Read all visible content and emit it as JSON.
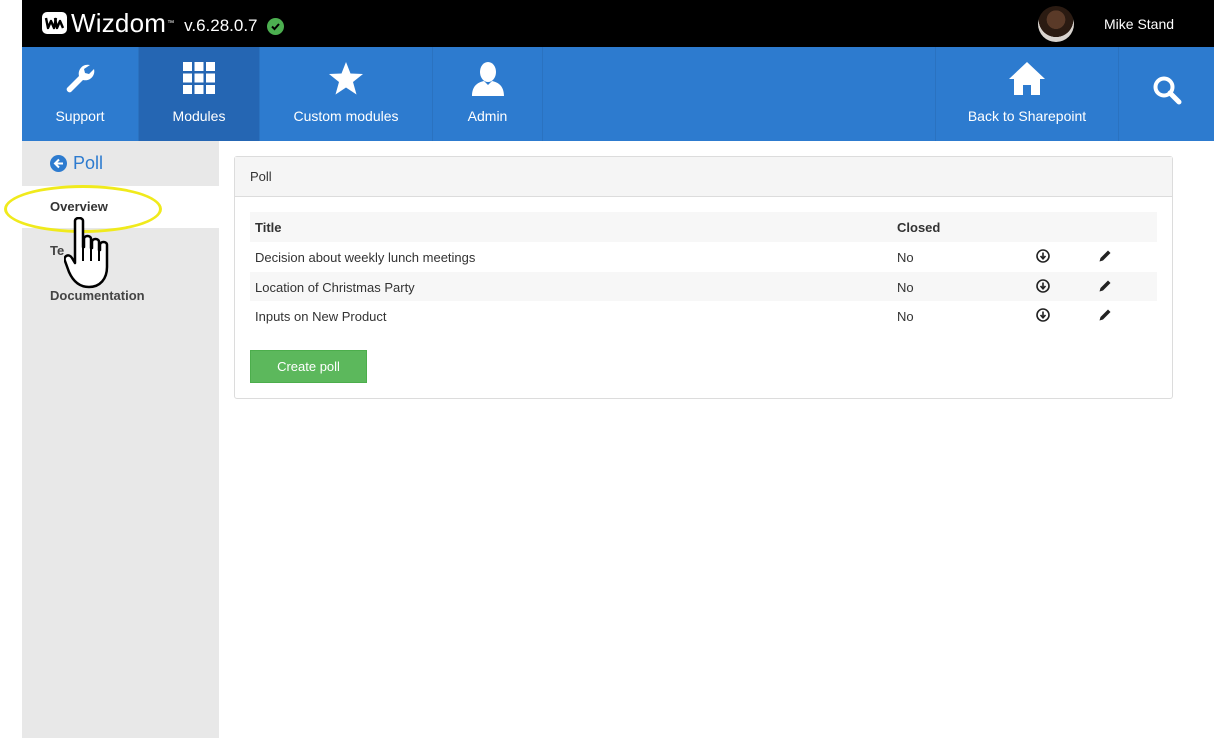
{
  "topbar": {
    "logo_text": "Wizdom",
    "logo_tm": "™",
    "version": "v.6.28.0.7",
    "user_name": "Mike Stand"
  },
  "nav": {
    "items": [
      {
        "label": "Support",
        "icon": "wrench-icon"
      },
      {
        "label": "Modules",
        "icon": "grid-icon",
        "active": true
      },
      {
        "label": "Custom modules",
        "icon": "star-icon"
      },
      {
        "label": "Admin",
        "icon": "user-icon"
      },
      {
        "label": "Back to Sharepoint",
        "icon": "home-icon"
      }
    ],
    "search_icon": "search-icon"
  },
  "sidebar": {
    "title": "Poll",
    "items": [
      {
        "label": "Overview",
        "active": true
      },
      {
        "label": "Te"
      },
      {
        "label": "Documentation"
      }
    ]
  },
  "panel": {
    "title": "Poll",
    "columns": {
      "title": "Title",
      "closed": "Closed"
    },
    "rows": [
      {
        "title": "Decision about weekly lunch meetings",
        "closed": "No"
      },
      {
        "title": "Location of Christmas Party",
        "closed": "No"
      },
      {
        "title": "Inputs on New Product",
        "closed": "No"
      }
    ],
    "create_button": "Create poll"
  },
  "colors": {
    "nav_blue": "#2d7bcf",
    "nav_active": "#2566b3",
    "create_green": "#5cb85c",
    "highlight_yellow": "#f0ea1c"
  }
}
